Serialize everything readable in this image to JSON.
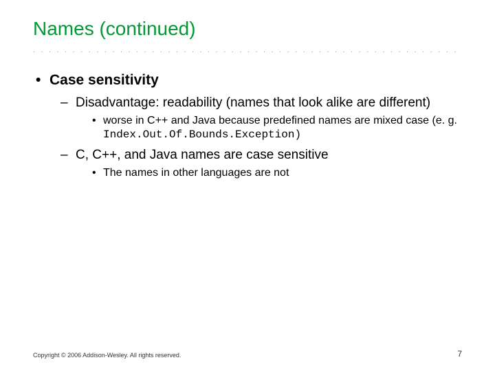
{
  "title": "Names (continued)",
  "bullets": {
    "b1": "Case sensitivity",
    "b2a": "Disadvantage: readability (names that look alike are different)",
    "b3a": "worse in C++ and Java  because predefined  names are mixed case  (e. g.",
    "code": "Index.Out.Of.Bounds.Exception)",
    "b2b": "C, C++, and Java names are case sensitive",
    "b3b": "The names in other languages are not"
  },
  "footer": "Copyright © 2006 Addison-Wesley. All rights reserved.",
  "page": "7"
}
